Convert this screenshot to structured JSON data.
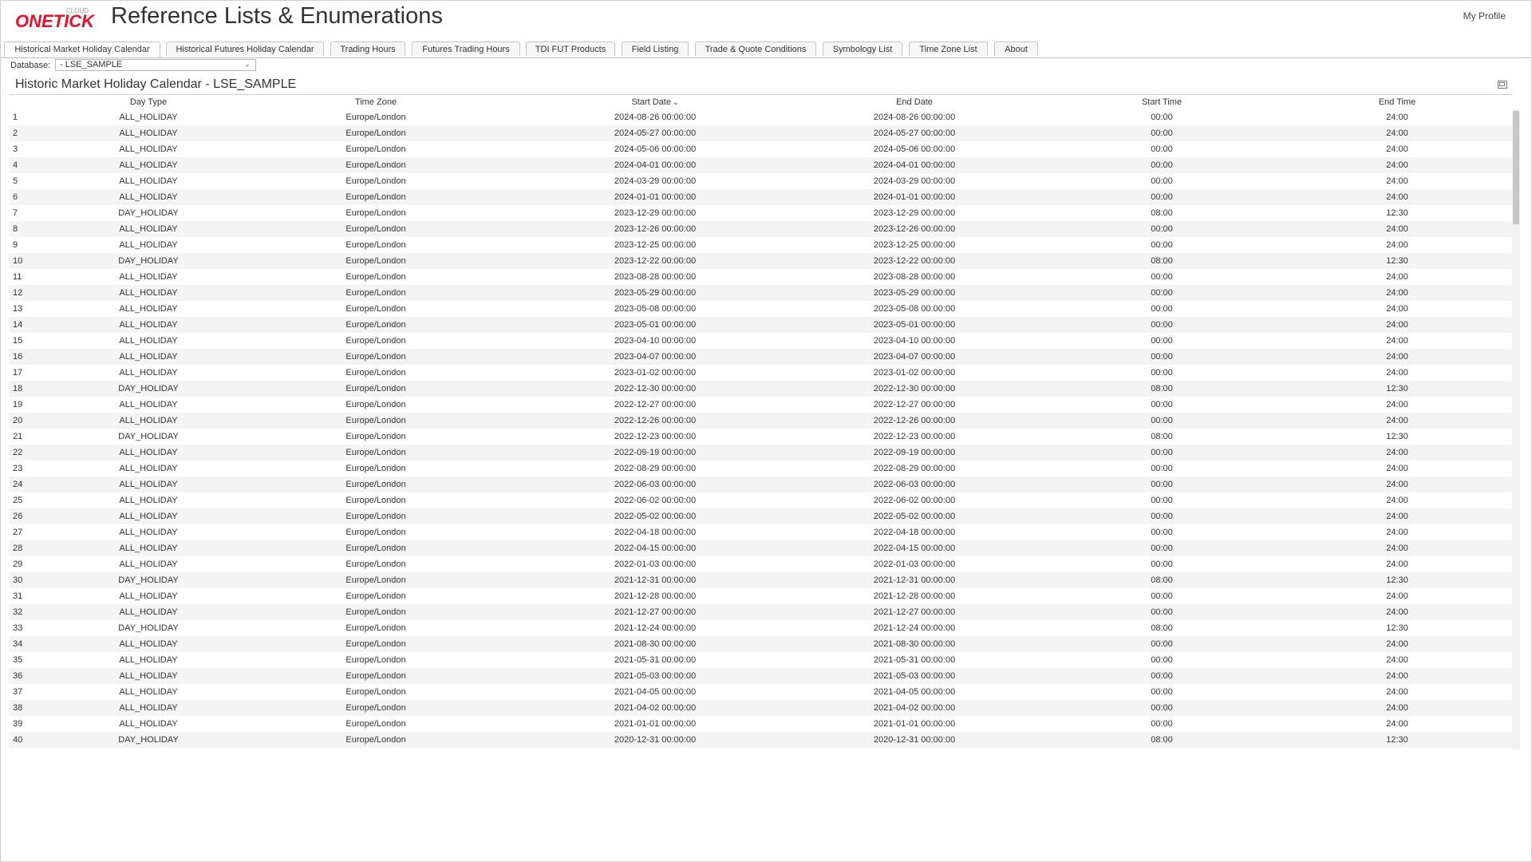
{
  "header": {
    "logo_main": "ONETICK",
    "logo_sub": "CLOUD",
    "title": "Reference Lists & Enumerations",
    "profile_label": "My Profile",
    "colors": {
      "logo_red": "#e3122b",
      "logo_grey": "#9a9a9a"
    }
  },
  "tabs": [
    {
      "label": "Historical Market Holiday Calendar",
      "active": true
    },
    {
      "label": "Historical Futures Holiday Calendar"
    },
    {
      "label": "Trading Hours"
    },
    {
      "label": "Futures Trading Hours"
    },
    {
      "label": "TDI FUT Products"
    },
    {
      "label": "Field Listing"
    },
    {
      "label": "Trade & Quote Conditions"
    },
    {
      "label": "Symbology List"
    },
    {
      "label": "Time Zone List"
    },
    {
      "label": "About"
    }
  ],
  "database": {
    "label": "Database:",
    "value": "- LSE_SAMPLE"
  },
  "panel": {
    "title": "Historic Market Holiday Calendar - LSE_SAMPLE",
    "restore_icon": "window-restore-icon"
  },
  "table": {
    "columns": [
      "Day Type",
      "Time Zone",
      "Start Date",
      "End Date",
      "Start Time",
      "End Time"
    ],
    "sorted_column": "Start Date",
    "sort_direction": "descending",
    "rows": [
      [
        "1",
        "ALL_HOLIDAY",
        "Europe/London",
        "2024-08-26 00:00:00",
        "2024-08-26 00:00:00",
        "00:00",
        "24:00"
      ],
      [
        "2",
        "ALL_HOLIDAY",
        "Europe/London",
        "2024-05-27 00:00:00",
        "2024-05-27 00:00:00",
        "00:00",
        "24:00"
      ],
      [
        "3",
        "ALL_HOLIDAY",
        "Europe/London",
        "2024-05-06 00:00:00",
        "2024-05-06 00:00:00",
        "00:00",
        "24:00"
      ],
      [
        "4",
        "ALL_HOLIDAY",
        "Europe/London",
        "2024-04-01 00:00:00",
        "2024-04-01 00:00:00",
        "00:00",
        "24:00"
      ],
      [
        "5",
        "ALL_HOLIDAY",
        "Europe/London",
        "2024-03-29 00:00:00",
        "2024-03-29 00:00:00",
        "00:00",
        "24:00"
      ],
      [
        "6",
        "ALL_HOLIDAY",
        "Europe/London",
        "2024-01-01 00:00:00",
        "2024-01-01 00:00:00",
        "00:00",
        "24:00"
      ],
      [
        "7",
        "DAY_HOLIDAY",
        "Europe/London",
        "2023-12-29 00:00:00",
        "2023-12-29 00:00:00",
        "08:00",
        "12:30"
      ],
      [
        "8",
        "ALL_HOLIDAY",
        "Europe/London",
        "2023-12-26 00:00:00",
        "2023-12-26 00:00:00",
        "00:00",
        "24:00"
      ],
      [
        "9",
        "ALL_HOLIDAY",
        "Europe/London",
        "2023-12-25 00:00:00",
        "2023-12-25 00:00:00",
        "00:00",
        "24:00"
      ],
      [
        "10",
        "DAY_HOLIDAY",
        "Europe/London",
        "2023-12-22 00:00:00",
        "2023-12-22 00:00:00",
        "08:00",
        "12:30"
      ],
      [
        "11",
        "ALL_HOLIDAY",
        "Europe/London",
        "2023-08-28 00:00:00",
        "2023-08-28 00:00:00",
        "00:00",
        "24:00"
      ],
      [
        "12",
        "ALL_HOLIDAY",
        "Europe/London",
        "2023-05-29 00:00:00",
        "2023-05-29 00:00:00",
        "00:00",
        "24:00"
      ],
      [
        "13",
        "ALL_HOLIDAY",
        "Europe/London",
        "2023-05-08 00:00:00",
        "2023-05-08 00:00:00",
        "00:00",
        "24:00"
      ],
      [
        "14",
        "ALL_HOLIDAY",
        "Europe/London",
        "2023-05-01 00:00:00",
        "2023-05-01 00:00:00",
        "00:00",
        "24:00"
      ],
      [
        "15",
        "ALL_HOLIDAY",
        "Europe/London",
        "2023-04-10 00:00:00",
        "2023-04-10 00:00:00",
        "00:00",
        "24:00"
      ],
      [
        "16",
        "ALL_HOLIDAY",
        "Europe/London",
        "2023-04-07 00:00:00",
        "2023-04-07 00:00:00",
        "00:00",
        "24:00"
      ],
      [
        "17",
        "ALL_HOLIDAY",
        "Europe/London",
        "2023-01-02 00:00:00",
        "2023-01-02 00:00:00",
        "00:00",
        "24:00"
      ],
      [
        "18",
        "DAY_HOLIDAY",
        "Europe/London",
        "2022-12-30 00:00:00",
        "2022-12-30 00:00:00",
        "08:00",
        "12:30"
      ],
      [
        "19",
        "ALL_HOLIDAY",
        "Europe/London",
        "2022-12-27 00:00:00",
        "2022-12-27 00:00:00",
        "00:00",
        "24:00"
      ],
      [
        "20",
        "ALL_HOLIDAY",
        "Europe/London",
        "2022-12-26 00:00:00",
        "2022-12-26 00:00:00",
        "00:00",
        "24:00"
      ],
      [
        "21",
        "DAY_HOLIDAY",
        "Europe/London",
        "2022-12-23 00:00:00",
        "2022-12-23 00:00:00",
        "08:00",
        "12:30"
      ],
      [
        "22",
        "ALL_HOLIDAY",
        "Europe/London",
        "2022-09-19 00:00:00",
        "2022-09-19 00:00:00",
        "00:00",
        "24:00"
      ],
      [
        "23",
        "ALL_HOLIDAY",
        "Europe/London",
        "2022-08-29 00:00:00",
        "2022-08-29 00:00:00",
        "00:00",
        "24:00"
      ],
      [
        "24",
        "ALL_HOLIDAY",
        "Europe/London",
        "2022-06-03 00:00:00",
        "2022-06-03 00:00:00",
        "00:00",
        "24:00"
      ],
      [
        "25",
        "ALL_HOLIDAY",
        "Europe/London",
        "2022-06-02 00:00:00",
        "2022-06-02 00:00:00",
        "00:00",
        "24:00"
      ],
      [
        "26",
        "ALL_HOLIDAY",
        "Europe/London",
        "2022-05-02 00:00:00",
        "2022-05-02 00:00:00",
        "00:00",
        "24:00"
      ],
      [
        "27",
        "ALL_HOLIDAY",
        "Europe/London",
        "2022-04-18 00:00:00",
        "2022-04-18 00:00:00",
        "00:00",
        "24:00"
      ],
      [
        "28",
        "ALL_HOLIDAY",
        "Europe/London",
        "2022-04-15 00:00:00",
        "2022-04-15 00:00:00",
        "00:00",
        "24:00"
      ],
      [
        "29",
        "ALL_HOLIDAY",
        "Europe/London",
        "2022-01-03 00:00:00",
        "2022-01-03 00:00:00",
        "00:00",
        "24:00"
      ],
      [
        "30",
        "DAY_HOLIDAY",
        "Europe/London",
        "2021-12-31 00:00:00",
        "2021-12-31 00:00:00",
        "08:00",
        "12:30"
      ],
      [
        "31",
        "ALL_HOLIDAY",
        "Europe/London",
        "2021-12-28 00:00:00",
        "2021-12-28 00:00:00",
        "00:00",
        "24:00"
      ],
      [
        "32",
        "ALL_HOLIDAY",
        "Europe/London",
        "2021-12-27 00:00:00",
        "2021-12-27 00:00:00",
        "00:00",
        "24:00"
      ],
      [
        "33",
        "DAY_HOLIDAY",
        "Europe/London",
        "2021-12-24 00:00:00",
        "2021-12-24 00:00:00",
        "08:00",
        "12:30"
      ],
      [
        "34",
        "ALL_HOLIDAY",
        "Europe/London",
        "2021-08-30 00:00:00",
        "2021-08-30 00:00:00",
        "00:00",
        "24:00"
      ],
      [
        "35",
        "ALL_HOLIDAY",
        "Europe/London",
        "2021-05-31 00:00:00",
        "2021-05-31 00:00:00",
        "00:00",
        "24:00"
      ],
      [
        "36",
        "ALL_HOLIDAY",
        "Europe/London",
        "2021-05-03 00:00:00",
        "2021-05-03 00:00:00",
        "00:00",
        "24:00"
      ],
      [
        "37",
        "ALL_HOLIDAY",
        "Europe/London",
        "2021-04-05 00:00:00",
        "2021-04-05 00:00:00",
        "00:00",
        "24:00"
      ],
      [
        "38",
        "ALL_HOLIDAY",
        "Europe/London",
        "2021-04-02 00:00:00",
        "2021-04-02 00:00:00",
        "00:00",
        "24:00"
      ],
      [
        "39",
        "ALL_HOLIDAY",
        "Europe/London",
        "2021-01-01 00:00:00",
        "2021-01-01 00:00:00",
        "00:00",
        "24:00"
      ],
      [
        "40",
        "DAY_HOLIDAY",
        "Europe/London",
        "2020-12-31 00:00:00",
        "2020-12-31 00:00:00",
        "08:00",
        "12:30"
      ]
    ]
  }
}
